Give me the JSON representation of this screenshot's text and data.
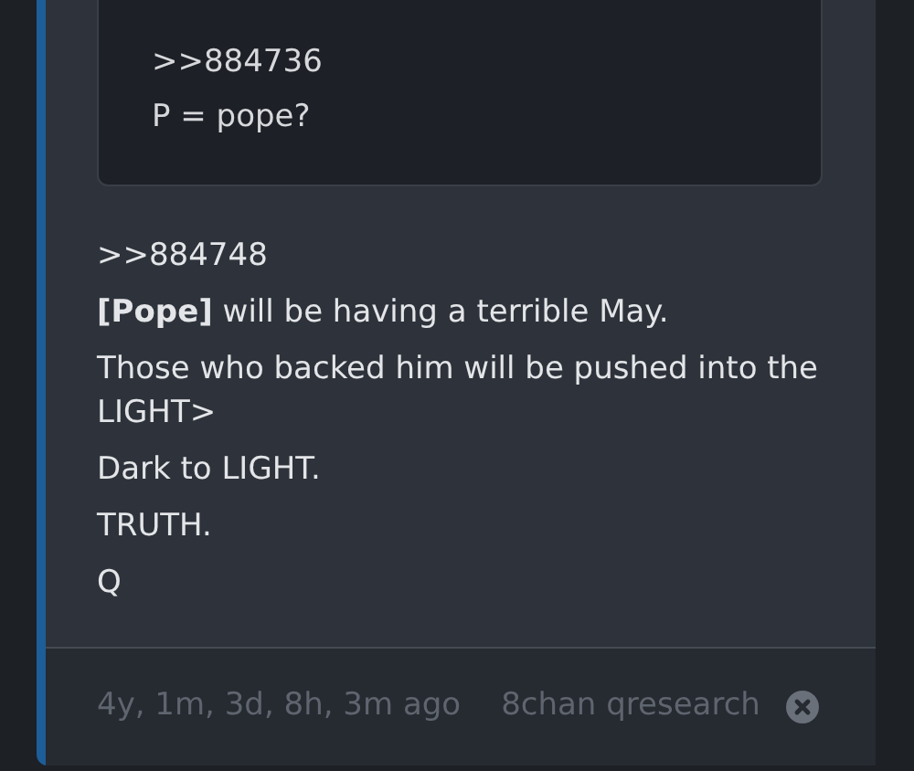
{
  "quoted_post": {
    "lines": [
      ">>884736",
      "P = pope?"
    ]
  },
  "post": {
    "lines": [
      ">>884748",
      "**[Pope]** will be having a terrible May.",
      "Those who backed him will be pushed into the LIGHT>",
      "Dark to LIGHT.",
      "TRUTH.",
      "Q"
    ]
  },
  "footer": {
    "time": "4y, 1m, 3d, 8h, 3m ago",
    "source": "8chan qresearch"
  }
}
